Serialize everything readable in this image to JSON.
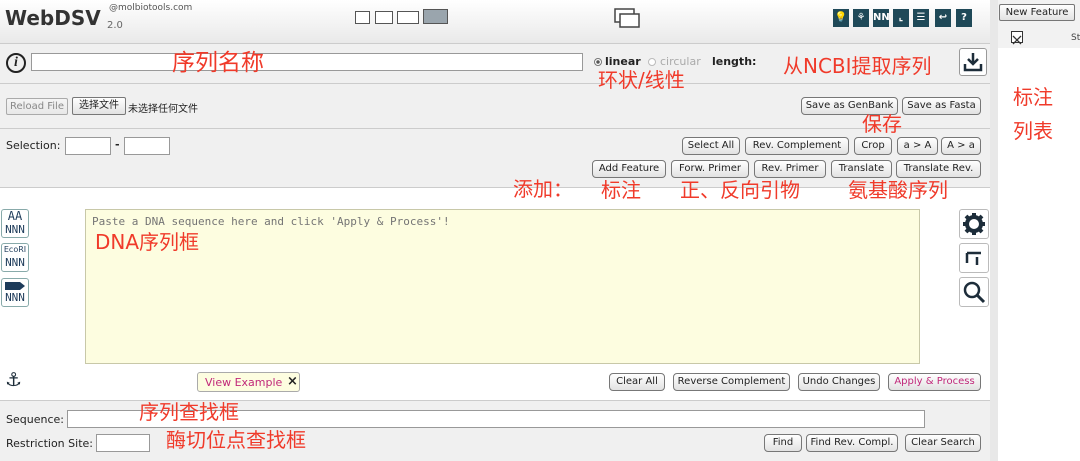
{
  "app": {
    "title": "WebDSV",
    "brand": "@molbiotools.com",
    "version": "2.0"
  },
  "toolbar": {
    "icon_letters": [
      "NN"
    ]
  },
  "name_row": {
    "name_value": "",
    "linear": "linear",
    "circular": "circular",
    "length_label": "length:",
    "topology_selected": "linear"
  },
  "file_row": {
    "reload": "Reload File",
    "choose": "选择文件",
    "no_file": "未选择任何文件",
    "save_genbank": "Save as GenBank",
    "save_fasta": "Save as Fasta"
  },
  "selection_row": {
    "label": "Selection:",
    "dash": "-",
    "buttons_row1": [
      "Select All",
      "Rev. Complement",
      "Crop",
      "a > A",
      "A > a"
    ],
    "buttons_row2": [
      "Add Feature",
      "Forw. Primer",
      "Rev. Primer",
      "Translate",
      "Translate Rev."
    ]
  },
  "editor": {
    "placeholder": "Paste a DNA sequence here and click 'Apply & Process'!",
    "left_icons": [
      {
        "top": "AA",
        "bottom": "NNN"
      },
      {
        "top": "EcoRI",
        "bottom": "NNN"
      },
      {
        "top": "",
        "bottom": "NNN"
      }
    ]
  },
  "action_row": {
    "view_example": "View Example",
    "close": "×",
    "clear_all": "Clear All",
    "reverse_complement": "Reverse Complement",
    "undo": "Undo Changes",
    "apply": "Apply & Process"
  },
  "search": {
    "sequence_label": "Sequence:",
    "restriction_label": "Restriction Site:",
    "find": "Find",
    "find_rev": "Find Rev. Compl.",
    "clear_search": "Clear Search"
  },
  "right_panel": {
    "new_feature": "New Feature",
    "col": "St"
  },
  "annotations": {
    "seq_name": "序列名称",
    "ncbi": "从NCBI提取序列",
    "topology": "环状/线性",
    "save": "保存",
    "add": "添加：",
    "feature": "标注",
    "primers": "正、反向引物",
    "aa": "氨基酸序列",
    "dna_box": "DNA序列框",
    "seq_search": "序列查找框",
    "enzyme_search": "酶切位点查找框",
    "feature_list_1": "标注",
    "feature_list_2": "列表"
  },
  "colors": {
    "accent_dark": "#1f4958",
    "annotation_red": "#f03a2a",
    "editor_bg": "#fdfde0",
    "panel_bg": "#f0f0f0"
  }
}
